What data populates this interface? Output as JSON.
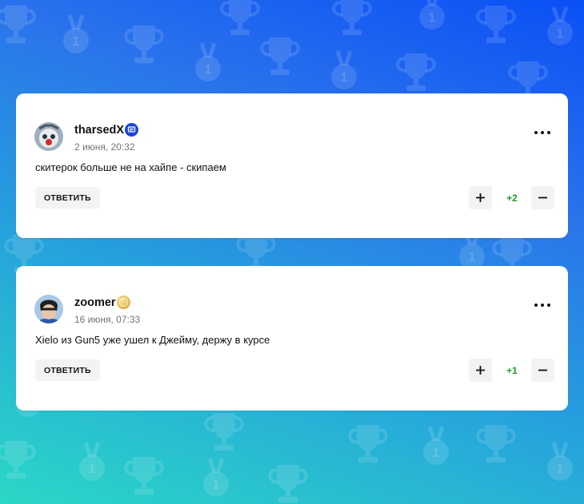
{
  "comments": [
    {
      "username": "tharsedX",
      "badge_icon": "blue-chat-badge-icon",
      "date": "2 июня, 20:32",
      "text": "скитерок больше не на хайпе - скипаем",
      "reply_label": "ОТВЕТИТЬ",
      "score": "+2",
      "plus_symbol": "+",
      "minus_symbol": "–",
      "more_icon": "more-dots-icon"
    },
    {
      "username": "zoomer",
      "badge_icon": "gold-coin-badge-icon",
      "date": "16 июня, 07:33",
      "text": "Xielo из Gun5 уже ушел к Джейму, держу в курсе",
      "reply_label": "ОТВЕТИТЬ",
      "score": "+1",
      "plus_symbol": "+",
      "minus_symbol": "–",
      "more_icon": "more-dots-icon"
    }
  ],
  "colors": {
    "score_positive": "#1a9a2a",
    "badge_blue": "#1a45d8",
    "badge_gold": "#e3b94a",
    "background_top": "#0a4ff5",
    "background_bottom": "#2bd7c6"
  }
}
